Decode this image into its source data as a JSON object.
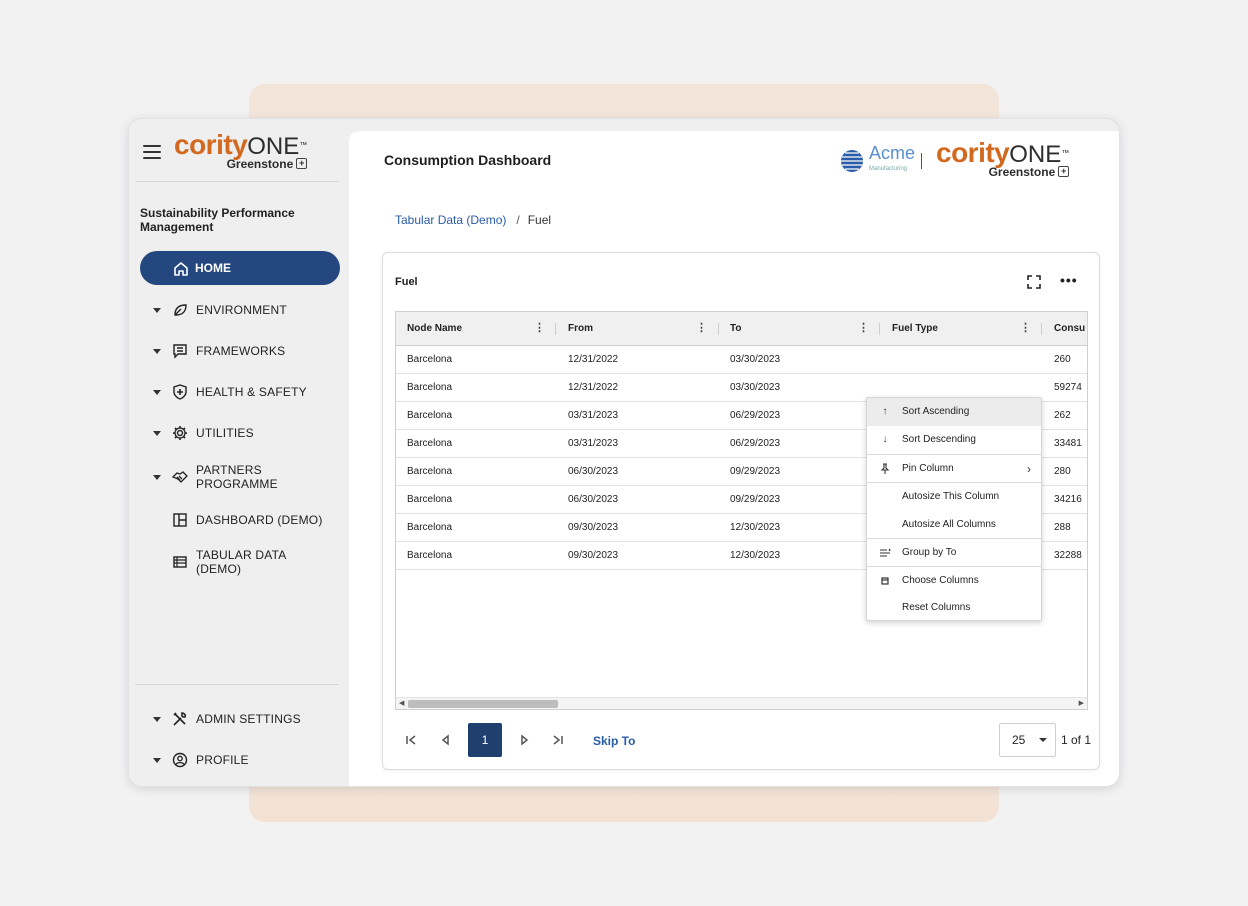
{
  "brand": {
    "name": "cority",
    "one": "ONE",
    "tm": "™",
    "sub": "Greenstone",
    "accent": "#d2691e",
    "navy": "#24477f"
  },
  "partner": {
    "name": "Acme",
    "tagline": "Manufacturing"
  },
  "sidebar": {
    "section_title": "Sustainability Performance Management",
    "home": "HOME",
    "items": [
      {
        "label": "ENVIRONMENT",
        "icon": "leaf-icon"
      },
      {
        "label": "FRAMEWORKS",
        "icon": "chat-icon"
      },
      {
        "label": "HEALTH & SAFETY",
        "icon": "shield-icon"
      },
      {
        "label": "UTILITIES",
        "icon": "gear-icon"
      },
      {
        "label": "PARTNERS PROGRAMME",
        "icon": "handshake-icon"
      },
      {
        "label": "DASHBOARD (DEMO)",
        "icon": "dashboard-icon"
      },
      {
        "label": "TABULAR DATA (DEMO)",
        "icon": "table-icon"
      }
    ],
    "admin": "ADMIN SETTINGS",
    "profile": "PROFILE"
  },
  "main": {
    "title": "Consumption Dashboard",
    "breadcrumb": {
      "parent": "Tabular Data (Demo)",
      "separator": "/",
      "current": "Fuel"
    },
    "card_title": "Fuel"
  },
  "grid": {
    "columns": [
      "Node Name",
      "From",
      "To",
      "Fuel Type",
      "Consu"
    ],
    "rows": [
      [
        "Barcelona",
        "12/31/2022",
        "03/30/2023",
        "260"
      ],
      [
        "Barcelona",
        "12/31/2022",
        "03/30/2023",
        "59274"
      ],
      [
        "Barcelona",
        "03/31/2023",
        "06/29/2023",
        "262"
      ],
      [
        "Barcelona",
        "03/31/2023",
        "06/29/2023",
        "33481"
      ],
      [
        "Barcelona",
        "06/30/2023",
        "09/29/2023",
        "280"
      ],
      [
        "Barcelona",
        "06/30/2023",
        "09/29/2023",
        "34216"
      ],
      [
        "Barcelona",
        "09/30/2023",
        "12/30/2023",
        "288"
      ],
      [
        "Barcelona",
        "09/30/2023",
        "12/30/2023",
        "32288"
      ]
    ]
  },
  "column_menu": {
    "sort_asc": "Sort Ascending",
    "sort_desc": "Sort Descending",
    "pin": "Pin Column",
    "autosize_this": "Autosize This Column",
    "autosize_all": "Autosize All Columns",
    "group_by": "Group by To",
    "choose": "Choose Columns",
    "reset": "Reset Columns"
  },
  "pager": {
    "current_page": "1",
    "skip_label": "Skip To",
    "page_size": "25",
    "page_of": "1 of 1"
  }
}
